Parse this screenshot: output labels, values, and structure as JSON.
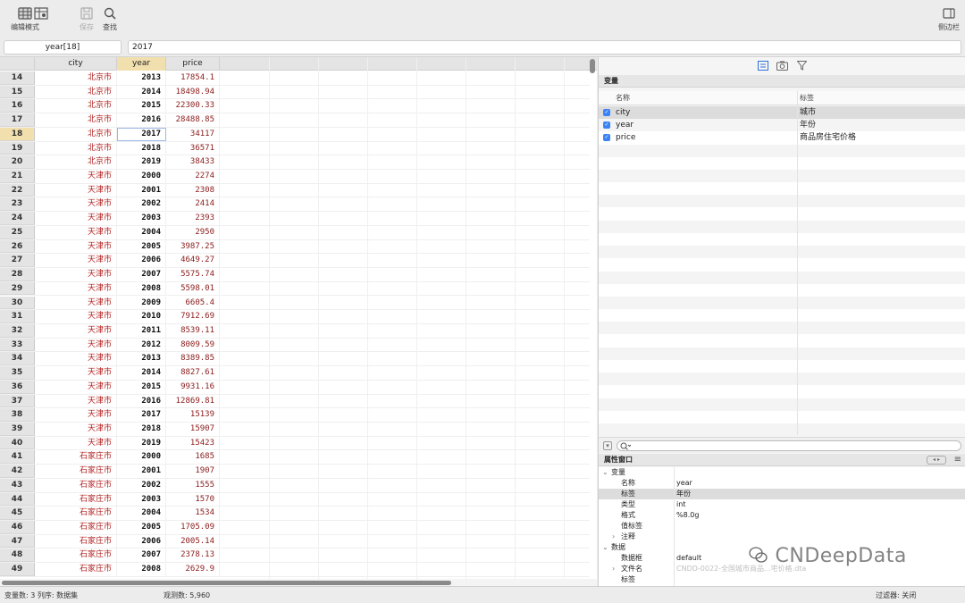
{
  "toolbar": {
    "edit_mode_label": "编辑模式",
    "save_label": "保存",
    "find_label": "查找",
    "sidebar_label": "侧边栏"
  },
  "cmdbar": {
    "cell_ref": "year[18]",
    "cell_value": "2017"
  },
  "grid": {
    "columns": [
      "city",
      "year",
      "price"
    ],
    "selected_column": "year",
    "selected_row": "18",
    "rows": [
      {
        "n": "14",
        "city": "北京市",
        "year": "2013",
        "price": "17854.1"
      },
      {
        "n": "15",
        "city": "北京市",
        "year": "2014",
        "price": "18498.94"
      },
      {
        "n": "16",
        "city": "北京市",
        "year": "2015",
        "price": "22300.33"
      },
      {
        "n": "17",
        "city": "北京市",
        "year": "2016",
        "price": "28488.85"
      },
      {
        "n": "18",
        "city": "北京市",
        "year": "2017",
        "price": "34117"
      },
      {
        "n": "19",
        "city": "北京市",
        "year": "2018",
        "price": "36571"
      },
      {
        "n": "20",
        "city": "北京市",
        "year": "2019",
        "price": "38433"
      },
      {
        "n": "21",
        "city": "天津市",
        "year": "2000",
        "price": "2274"
      },
      {
        "n": "22",
        "city": "天津市",
        "year": "2001",
        "price": "2308"
      },
      {
        "n": "23",
        "city": "天津市",
        "year": "2002",
        "price": "2414"
      },
      {
        "n": "24",
        "city": "天津市",
        "year": "2003",
        "price": "2393"
      },
      {
        "n": "25",
        "city": "天津市",
        "year": "2004",
        "price": "2950"
      },
      {
        "n": "26",
        "city": "天津市",
        "year": "2005",
        "price": "3987.25"
      },
      {
        "n": "27",
        "city": "天津市",
        "year": "2006",
        "price": "4649.27"
      },
      {
        "n": "28",
        "city": "天津市",
        "year": "2007",
        "price": "5575.74"
      },
      {
        "n": "29",
        "city": "天津市",
        "year": "2008",
        "price": "5598.01"
      },
      {
        "n": "30",
        "city": "天津市",
        "year": "2009",
        "price": "6605.4"
      },
      {
        "n": "31",
        "city": "天津市",
        "year": "2010",
        "price": "7912.69"
      },
      {
        "n": "32",
        "city": "天津市",
        "year": "2011",
        "price": "8539.11"
      },
      {
        "n": "33",
        "city": "天津市",
        "year": "2012",
        "price": "8009.59"
      },
      {
        "n": "34",
        "city": "天津市",
        "year": "2013",
        "price": "8389.85"
      },
      {
        "n": "35",
        "city": "天津市",
        "year": "2014",
        "price": "8827.61"
      },
      {
        "n": "36",
        "city": "天津市",
        "year": "2015",
        "price": "9931.16"
      },
      {
        "n": "37",
        "city": "天津市",
        "year": "2016",
        "price": "12869.81"
      },
      {
        "n": "38",
        "city": "天津市",
        "year": "2017",
        "price": "15139"
      },
      {
        "n": "39",
        "city": "天津市",
        "year": "2018",
        "price": "15907"
      },
      {
        "n": "40",
        "city": "天津市",
        "year": "2019",
        "price": "15423"
      },
      {
        "n": "41",
        "city": "石家庄市",
        "year": "2000",
        "price": "1685"
      },
      {
        "n": "42",
        "city": "石家庄市",
        "year": "2001",
        "price": "1907"
      },
      {
        "n": "43",
        "city": "石家庄市",
        "year": "2002",
        "price": "1555"
      },
      {
        "n": "44",
        "city": "石家庄市",
        "year": "2003",
        "price": "1570"
      },
      {
        "n": "45",
        "city": "石家庄市",
        "year": "2004",
        "price": "1534"
      },
      {
        "n": "46",
        "city": "石家庄市",
        "year": "2005",
        "price": "1705.09"
      },
      {
        "n": "47",
        "city": "石家庄市",
        "year": "2006",
        "price": "2005.14"
      },
      {
        "n": "48",
        "city": "石家庄市",
        "year": "2007",
        "price": "2378.13"
      },
      {
        "n": "49",
        "city": "石家庄市",
        "year": "2008",
        "price": "2629.9"
      }
    ]
  },
  "variables": {
    "title": "变量",
    "col_name": "名称",
    "col_label": "标签",
    "items": [
      {
        "name": "city",
        "label": "城市"
      },
      {
        "name": "year",
        "label": "年份"
      },
      {
        "name": "price",
        "label": "商品房住宅价格"
      }
    ]
  },
  "properties": {
    "title": "属性窗口",
    "rows": [
      {
        "key": "变量",
        "value": "",
        "level": 0,
        "arrow": "⌄"
      },
      {
        "key": "名称",
        "value": "year",
        "level": 1,
        "arrow": ""
      },
      {
        "key": "标签",
        "value": "年份",
        "level": 1,
        "arrow": "",
        "sel": true
      },
      {
        "key": "类型",
        "value": "int",
        "level": 1,
        "arrow": ""
      },
      {
        "key": "格式",
        "value": "%8.0g",
        "level": 1,
        "arrow": ""
      },
      {
        "key": "值标签",
        "value": "",
        "level": 1,
        "arrow": ""
      },
      {
        "key": "注释",
        "value": "",
        "level": 1,
        "arrow": "›"
      },
      {
        "key": "数据",
        "value": "",
        "level": 0,
        "arrow": "⌄"
      },
      {
        "key": "数据框",
        "value": "default",
        "level": 1,
        "arrow": ""
      },
      {
        "key": "文件名",
        "value": "CNDD-0022-全国城市商品...宅价格.dta",
        "level": 1,
        "arrow": "›",
        "muted": true
      },
      {
        "key": "标签",
        "value": "",
        "level": 1,
        "arrow": ""
      }
    ]
  },
  "watermark": "CNDeepData",
  "status": {
    "vars": "变量数: 3  列序: 数据集",
    "obs": "观测数: 5,960",
    "filter": "过滤器: 关闭"
  },
  "colors": {
    "selection": "#f2dfae",
    "city_text": "#b22222",
    "checkbox": "#3b82f6"
  }
}
